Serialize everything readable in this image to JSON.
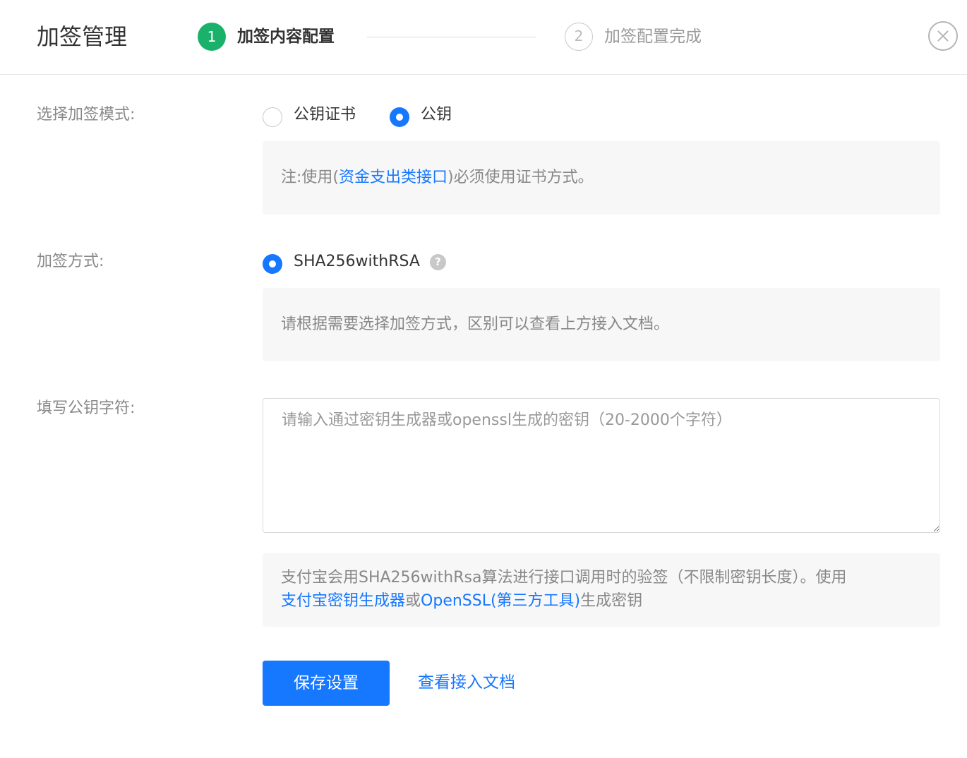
{
  "header": {
    "title": "加签管理",
    "steps": [
      {
        "number": "1",
        "label": "加签内容配置",
        "state": "active"
      },
      {
        "number": "2",
        "label": "加签配置完成",
        "state": "pending"
      }
    ],
    "close_icon": "close-circle-icon"
  },
  "sign_mode": {
    "label": "选择加签模式:",
    "options": [
      {
        "label": "公钥证书",
        "selected": false
      },
      {
        "label": "公钥",
        "selected": true
      }
    ],
    "note": {
      "prefix": "注:使用(",
      "link": "资金支出类接口",
      "suffix": ")必须使用证书方式。"
    }
  },
  "sign_method": {
    "label": "加签方式:",
    "option": {
      "label": "SHA256withRSA",
      "selected": true
    },
    "help_icon": "question-circle-icon",
    "help_symbol": "?",
    "note": "请根据需要选择加签方式，区别可以查看上方接入文档。"
  },
  "public_key": {
    "label": "填写公钥字符:",
    "value": "",
    "placeholder": "请输入通过密钥生成器或openssl生成的密钥（20-2000个字符）",
    "note": {
      "text1": "支付宝会用SHA256withRsa算法进行接口调用时的验签（不限制密钥长度）。使用",
      "link1": "支付宝密钥生成器",
      "text2": "或",
      "link2": "OpenSSL(第三方工具)",
      "text3": "生成密钥"
    }
  },
  "actions": {
    "save_label": "保存设置",
    "doc_link_label": "查看接入文档"
  },
  "colors": {
    "primary": "#1677ff",
    "step_active": "#1ab26b",
    "muted_text": "#888888",
    "note_bg": "#f7f7f7"
  }
}
